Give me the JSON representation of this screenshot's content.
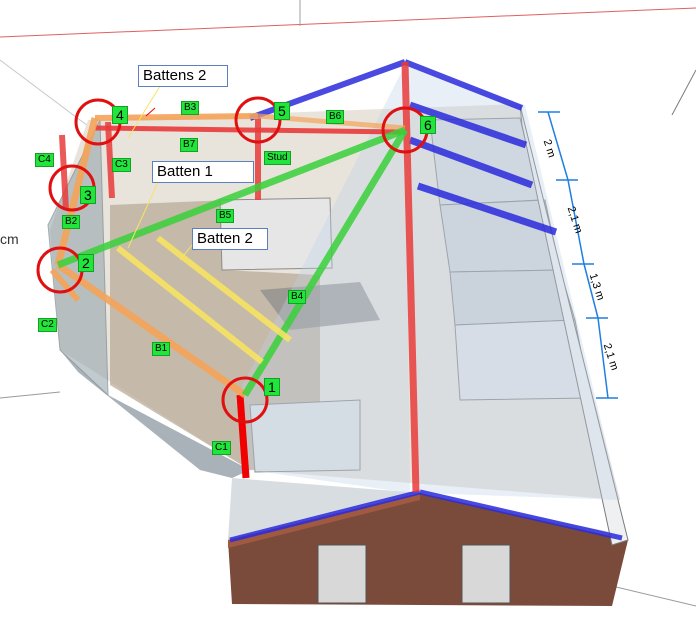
{
  "callouts": {
    "battens_2_top": "Battens 2",
    "batten_1": "Batten 1",
    "batten_2": "Batten 2"
  },
  "node_numbers": [
    "1",
    "2",
    "3",
    "4",
    "5",
    "6"
  ],
  "member_tags": {
    "b1": "B1",
    "b2": "B2",
    "b3": "B3",
    "b4": "B4",
    "b5": "B5",
    "b6": "B6",
    "b7": "B7",
    "c1": "C1",
    "c2": "C2",
    "c3": "C3",
    "c4": "C4",
    "stud": "Stud"
  },
  "dimensions": {
    "d1": "2 m",
    "d2": "2,1 m",
    "d3": "1,3 m",
    "d4": "2,1 m"
  },
  "left_edge_label": "cm",
  "colors": {
    "ridge_blue": "#2b2bdc",
    "rafter_red": "#e83b3b",
    "beam_orange": "#f5a45a",
    "brace_green": "#3ad13a",
    "batten_yellow": "#f6e463",
    "circle_red": "#e01010",
    "dimension_blue": "#1e7fe0",
    "tag_green": "#22e53b"
  }
}
